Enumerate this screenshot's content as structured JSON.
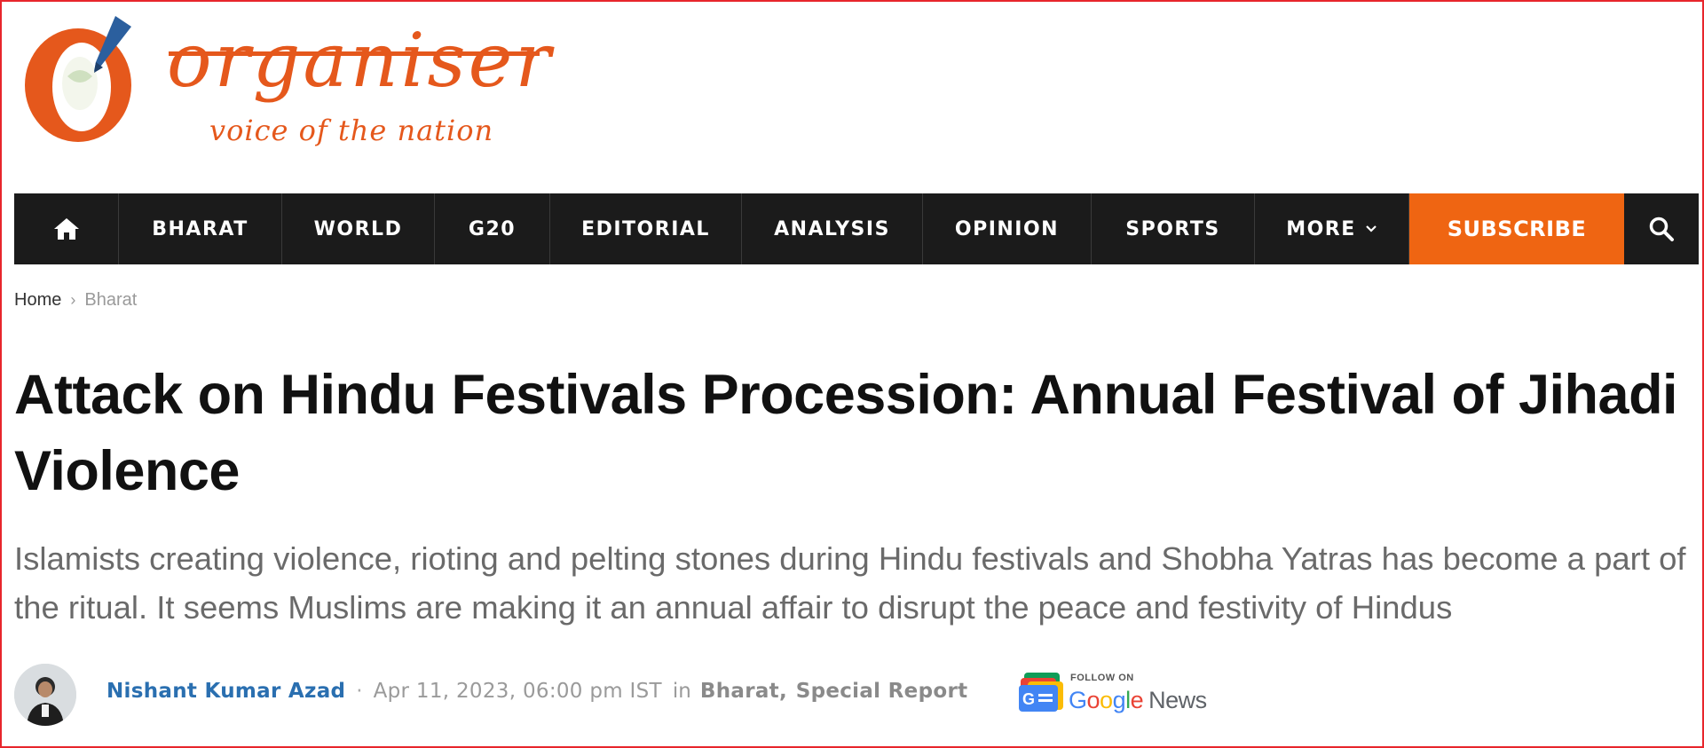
{
  "logo": {
    "wordmark": "organiser",
    "tagline": "voice of the nation",
    "brand_color": "#e5581c"
  },
  "nav": {
    "home_icon": "home-icon",
    "items": [
      {
        "label": "BHARAT"
      },
      {
        "label": "WORLD"
      },
      {
        "label": "G20"
      },
      {
        "label": "EDITORIAL"
      },
      {
        "label": "ANALYSIS"
      },
      {
        "label": "OPINION"
      },
      {
        "label": "SPORTS"
      },
      {
        "label": "MORE"
      }
    ],
    "more_icon": "chevron-down-icon",
    "subscribe_label": "SUBSCRIBE",
    "subscribe_color": "#ef6512",
    "search_icon": "search-icon",
    "background": "#1b1b1b"
  },
  "breadcrumb": {
    "home": "Home",
    "separator": "›",
    "current": "Bharat"
  },
  "article": {
    "headline": "Attack on Hindu Festivals Procession: Annual Festival of Jihadi Violence",
    "summary": "Islamists creating violence, rioting and pelting stones during Hindu festivals and Shobha Yatras has become a part of the ritual. It seems Muslims are making it an annual affair to disrupt the peace and festivity of Hindus"
  },
  "meta": {
    "author": "Nishant Kumar Azad",
    "separator": "·",
    "date": "Apr 11, 2023, 06:00 pm IST",
    "in_label": "in",
    "categories": [
      "Bharat",
      "Special Report"
    ],
    "author_color": "#2a6fb0"
  },
  "google_news": {
    "small_label": "FOLLOW ON",
    "label_google": "Google",
    "label_news": "News",
    "icon": "google-news-icon"
  }
}
